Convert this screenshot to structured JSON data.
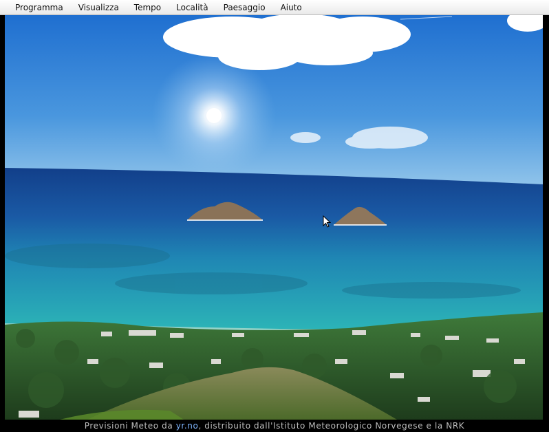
{
  "menu": {
    "items": [
      {
        "label": "Programma"
      },
      {
        "label": "Visualizza"
      },
      {
        "label": "Tempo"
      },
      {
        "label": "Località"
      },
      {
        "label": "Paesaggio"
      },
      {
        "label": "Aiuto"
      }
    ]
  },
  "footer": {
    "prefix": "Previsioni Meteo da",
    "link": "yr.no",
    "suffix": ", distribuito dall'Istituto Meteorologico Norvegese e la NRK"
  },
  "colors": {
    "sky_top": "#1f6fd0",
    "sky_horizon": "#8fc3ea",
    "sea_deep": "#1a4f9c",
    "sea_shallow": "#2aa8b0",
    "link": "#7fb6ff"
  }
}
